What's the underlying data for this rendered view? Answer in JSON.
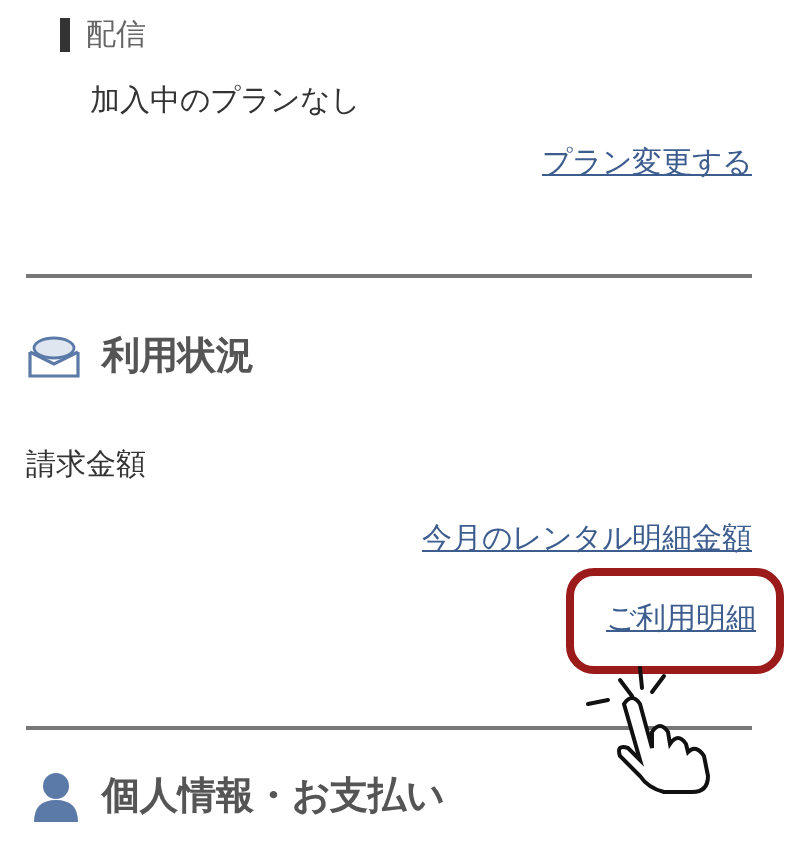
{
  "delivery": {
    "label": "配信",
    "plan_status": "加入中のプランなし",
    "change_link": "プラン変更する"
  },
  "usage": {
    "heading": "利用状況",
    "billing_label": "請求金額",
    "links": [
      {
        "text": "今月のレンタル明細金額",
        "highlighted": false
      },
      {
        "text": "ご利用明細",
        "highlighted": true
      }
    ]
  },
  "profile": {
    "heading": "個人情報・お支払い"
  }
}
